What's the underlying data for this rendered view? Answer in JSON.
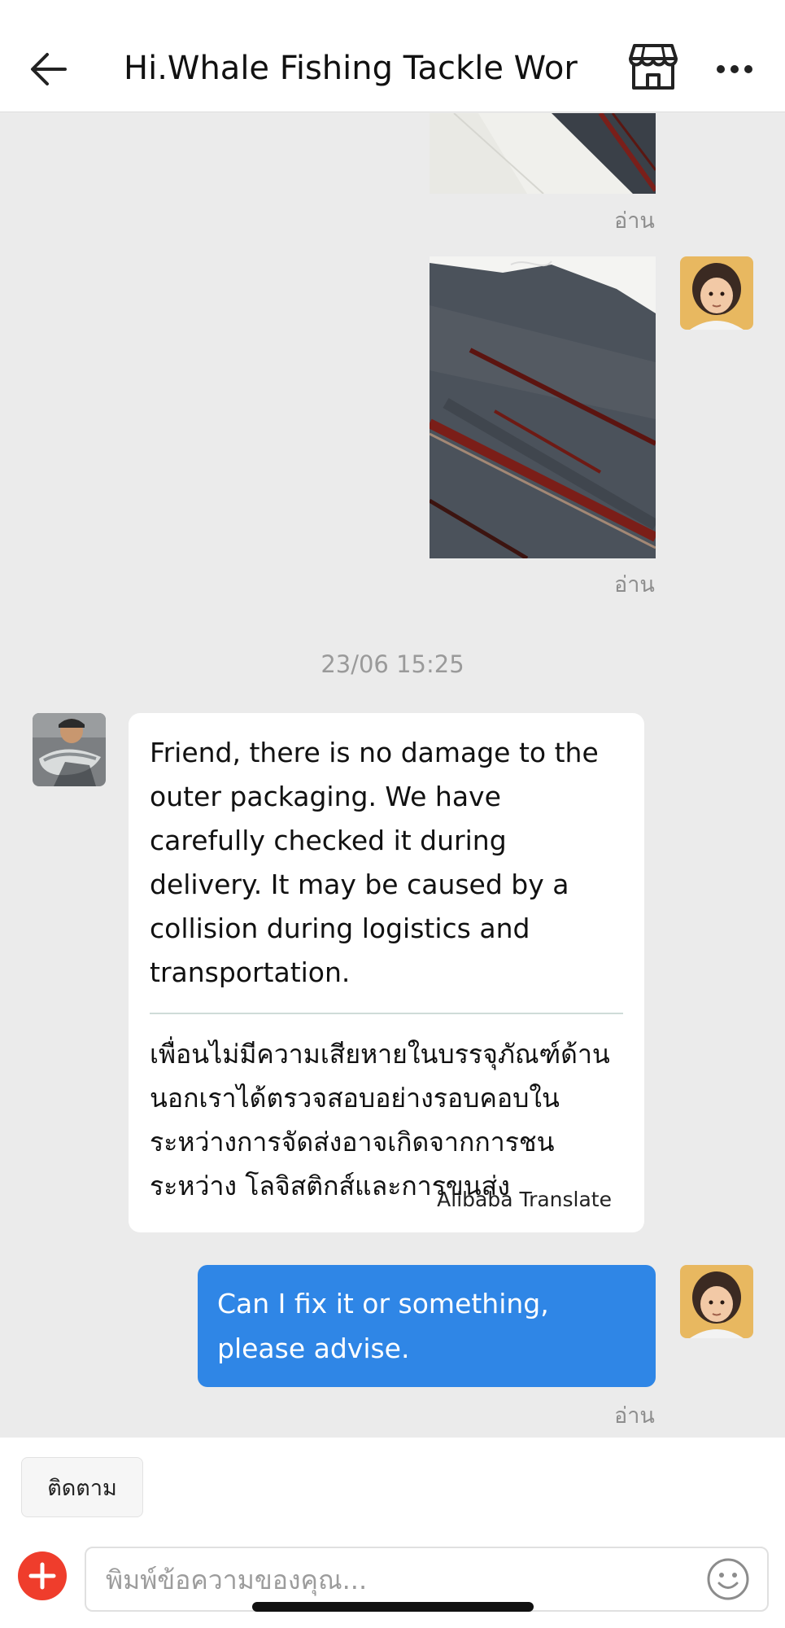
{
  "header": {
    "title": "Hi.Whale Fishing Tackle Worl..."
  },
  "chat": {
    "read_label_1": "อ่าน",
    "read_label_2": "อ่าน",
    "read_label_3": "อ่าน",
    "timestamp": "23/06 15:25",
    "incoming": {
      "text_en": "Friend, there is no damage to the outer packaging. We have carefully checked it during delivery. It may be caused by a collision during logistics and transportation.",
      "text_th": "เพื่อนไม่มีความเสียหายในบรรจุภัณฑ์ด้านนอกเราได้ตรวจสอบอย่างรอบคอบในระหว่างการจัดส่งอาจเกิดจากการชนระหว่าง โลจิสติกส์และการขนส่ง",
      "translate_note": "Alibaba Translate"
    },
    "outgoing": {
      "text": "Can I fix it or something, please advise."
    }
  },
  "bottom": {
    "follow_label": "ติดตาม",
    "input_placeholder": "พิมพ์ข้อความของคุณ..."
  },
  "colors": {
    "outgoing_bubble": "#2f86e6",
    "add_button": "#ef3d2c",
    "chat_background": "#ebebeb"
  },
  "icons": {
    "back": "arrow-left-icon",
    "store": "store-icon",
    "more": "more-dots-icon",
    "add": "plus-icon",
    "emoji": "smiley-icon"
  }
}
